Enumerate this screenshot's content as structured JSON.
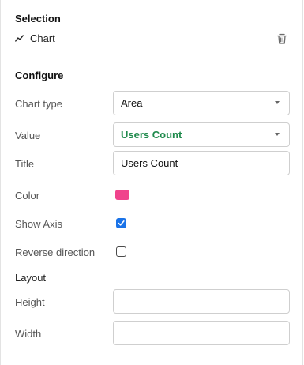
{
  "selection": {
    "title": "Selection",
    "item_label": "Chart",
    "item_icon": "line-chart-icon",
    "delete_icon": "trash-icon"
  },
  "configure": {
    "title": "Configure",
    "chart_type": {
      "label": "Chart type",
      "value": "Area"
    },
    "value": {
      "label": "Value",
      "selected": "Users Count",
      "color": "#1f8a4c"
    },
    "title_field": {
      "label": "Title",
      "value": "Users Count"
    },
    "color": {
      "label": "Color",
      "value": "#f0438c"
    },
    "show_axis": {
      "label": "Show Axis",
      "checked": true
    },
    "reverse_direction": {
      "label": "Reverse direction",
      "checked": false
    }
  },
  "layout": {
    "title": "Layout",
    "height": {
      "label": "Height",
      "value": ""
    },
    "width": {
      "label": "Width",
      "value": ""
    }
  },
  "colors": {
    "checkbox_accent": "#1a73e8"
  }
}
